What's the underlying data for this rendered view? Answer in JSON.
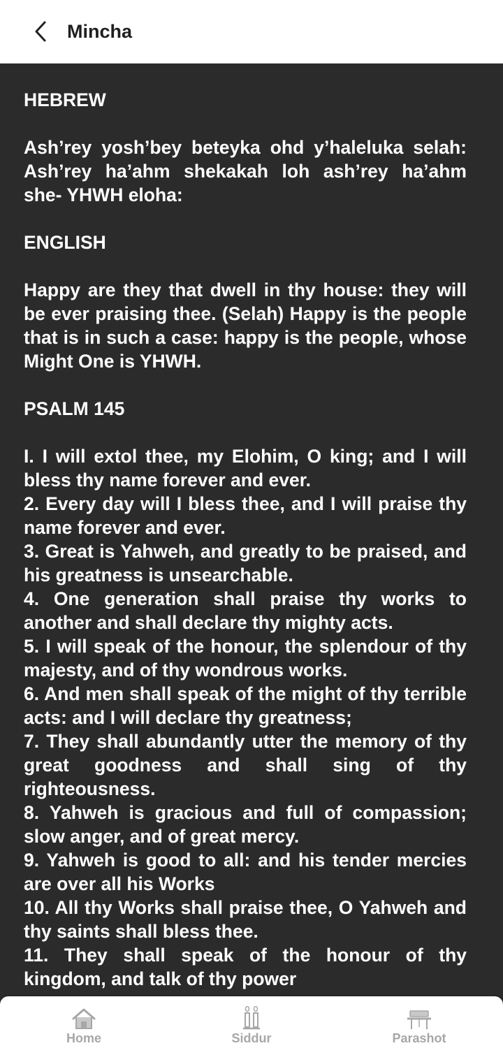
{
  "header": {
    "title": "Mincha"
  },
  "content": {
    "hebrew_heading": "HEBREW",
    "hebrew_text": "Ash’rey yosh’bey beteyka ohd y’haleluka selah: Ash’rey ha’ahm shekakah loh ash’rey ha’ahm she- YHWH eloha:",
    "english_heading": "ENGLISH",
    "english_text": "Happy are they that dwell in thy house: they will be ever praising thee. (Selah) Happy is the people that is in such a case: happy is the people, whose Might One is YHWH.",
    "psalm_heading": "PSALM 145",
    "verses": [
      "I. I will extol thee, my Elohim, O king; and I will bless thy name forever and ever.",
      "2. Every day will I bless thee, and I will praise thy name forever and ever.",
      "3. Great is Yahweh, and greatly to be praised, and his greatness is unsearchable.",
      "4. One generation shall praise thy works to another and shall declare thy mighty acts.",
      "5. I will speak of the honour, the splendour of thy majesty, and of thy wondrous works.",
      "6. And men shall speak of the might of thy terrible acts: and I will declare thy greatness;",
      "7. They shall abundantly utter the memory of thy great goodness and shall sing of thy righteousness.",
      "8. Yahweh is gracious and full of compassion; slow anger, and of great mercy.",
      "9. Yahweh is good to all: and his tender mercies are over all his Works",
      "10. All thy Works shall praise thee, O Yahweh and thy saints shall bless thee.",
      "11. They shall speak of the honour of thy kingdom, and talk of thy power"
    ]
  },
  "bottom_nav": {
    "items": [
      {
        "label": "Home",
        "icon": "home-icon"
      },
      {
        "label": "Siddur",
        "icon": "candles-icon"
      },
      {
        "label": "Parashot",
        "icon": "torah-table-icon"
      }
    ]
  }
}
